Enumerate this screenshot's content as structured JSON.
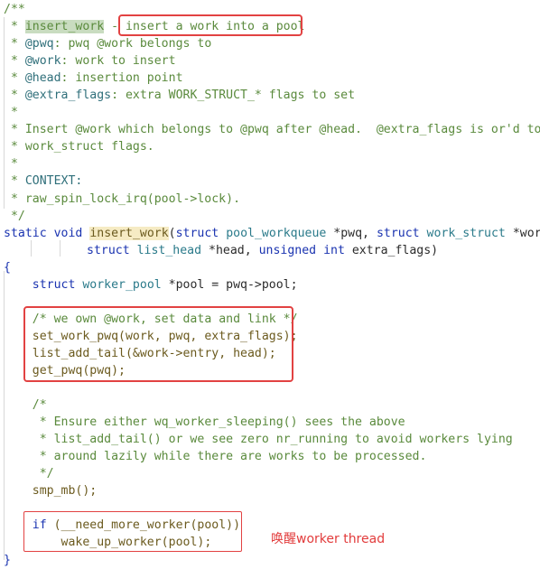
{
  "colors": {
    "comment": "#5a8a3c",
    "doc_tag": "#2f6f7a",
    "keyword": "#1a33b0",
    "type": "#2a7a8a",
    "function": "#6b5a1e",
    "annotation_red": "#e24242"
  },
  "code": {
    "l1": "/**",
    "l2_star": " * ",
    "l2_name": "insert_work",
    "l2_dash": " - ",
    "l2_desc": "insert a work into a pool",
    "l3_a": " * ",
    "l3_tag": "@pwq",
    "l3_b": ": pwq @work belongs to",
    "l4_a": " * ",
    "l4_tag": "@work",
    "l4_b": ": work to insert",
    "l5_a": " * ",
    "l5_tag": "@head",
    "l5_b": ": insertion point",
    "l6_a": " * ",
    "l6_tag": "@extra_flags",
    "l6_b": ": extra WORK_STRUCT_* flags to set",
    "l7": " *",
    "l8": " * Insert @work which belongs to @pwq after @head.  @extra_flags is or'd to",
    "l9": " * work_struct flags.",
    "l10": " *",
    "l11_a": " * ",
    "l11_tag": "CONTEXT:",
    "l12": " * raw_spin_lock_irq(pool->lock).",
    "l13": " */",
    "l14_static": "static",
    "l14_void": "void",
    "l14_fn": "insert_work",
    "l14_p1": "(",
    "l14_struct1": "struct",
    "l14_t1": "pool_workqueue",
    "l14_a1": " *pwq, ",
    "l14_struct2": "struct",
    "l14_t2": "work_struct",
    "l14_a2": " *work,",
    "l15_struct": "struct",
    "l15_t": "list_head",
    "l15_a": " *head, ",
    "l15_unsigned": "unsigned",
    "l15_int": "int",
    "l15_b": " extra_flags)",
    "l16": "{",
    "l17_struct": "struct",
    "l17_t": "worker_pool",
    "l17_a": " *pool = pwq->pool;",
    "l19": "/* we own @work, set data and link */",
    "l20": "set_work_pwq(work, pwq, extra_flags);",
    "l21": "list_add_tail(&work->entry, head);",
    "l22": "get_pwq(pwq);",
    "l24": "/*",
    "l25": " * Ensure either wq_worker_sleeping() sees the above",
    "l26": " * list_add_tail() or we see zero nr_running to avoid workers lying",
    "l27": " * around lazily while there are works to be processed.",
    "l28": " */",
    "l29": "smp_mb();",
    "l31_if": "if",
    "l31_b": " (__need_more_worker(pool))",
    "l32": "wake_up_worker(pool);",
    "l33": "}"
  },
  "annotation": {
    "note": "唤醒worker thread"
  }
}
